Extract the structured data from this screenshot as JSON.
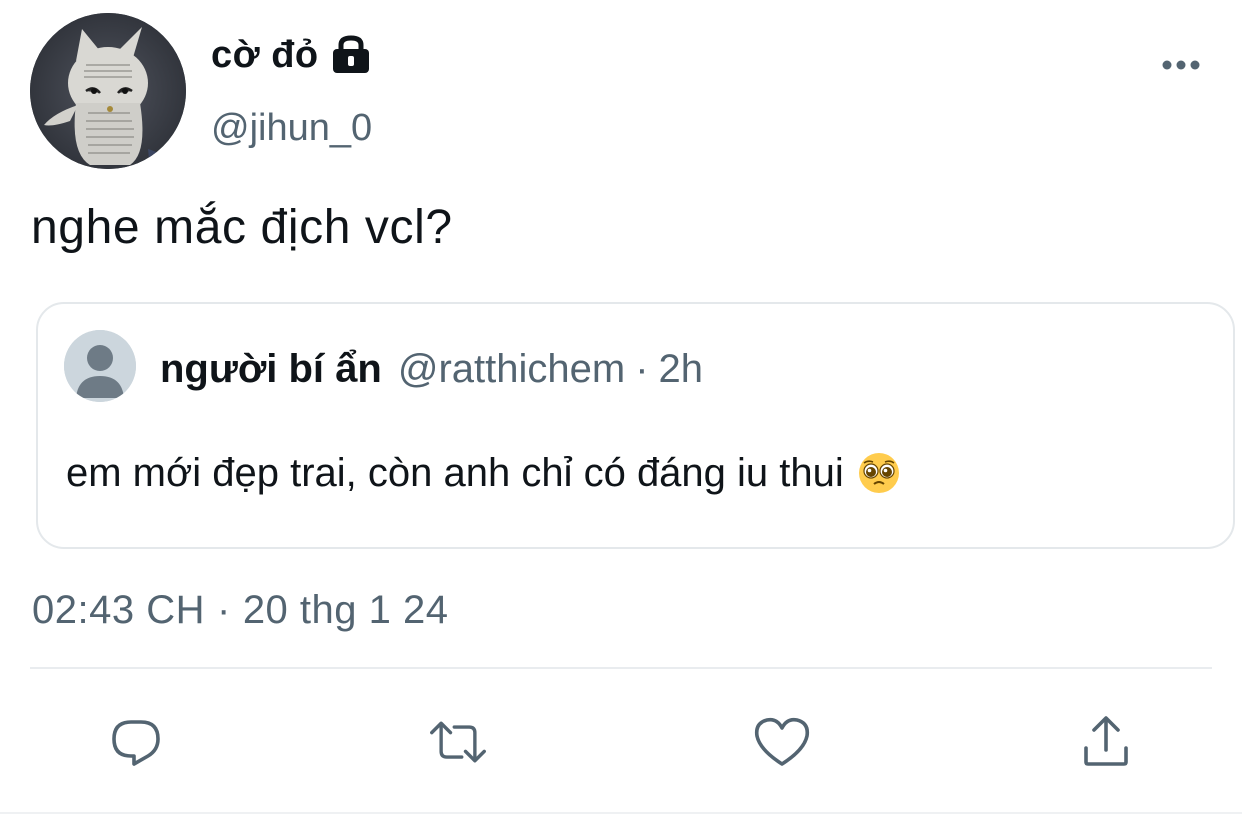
{
  "author": {
    "display_name": "cờ đỏ",
    "handle": "@jihun_0",
    "protected": true,
    "avatar_icon": "cat-avatar"
  },
  "tweet": {
    "text": "nghe mắc địch vcl?"
  },
  "quoted_tweet": {
    "display_name": "người bí ẩn",
    "handle": "@ratthichem",
    "separator": "·",
    "time_ago": "2h",
    "text": "em mới đẹp trai, còn anh chỉ có đáng iu thui",
    "emoji_icon": "pleading-face-icon"
  },
  "timestamp": {
    "time": "02:43 CH",
    "separator": "·",
    "date": "20 thg 1 24"
  },
  "actions": [
    {
      "name": "reply",
      "icon": "reply-icon"
    },
    {
      "name": "retweet",
      "icon": "retweet-icon"
    },
    {
      "name": "like",
      "icon": "heart-icon"
    },
    {
      "name": "share",
      "icon": "share-icon"
    }
  ],
  "colors": {
    "text_primary": "#0f1419",
    "text_secondary": "#536471",
    "border": "#e4e8eb",
    "icon": "#536471"
  }
}
